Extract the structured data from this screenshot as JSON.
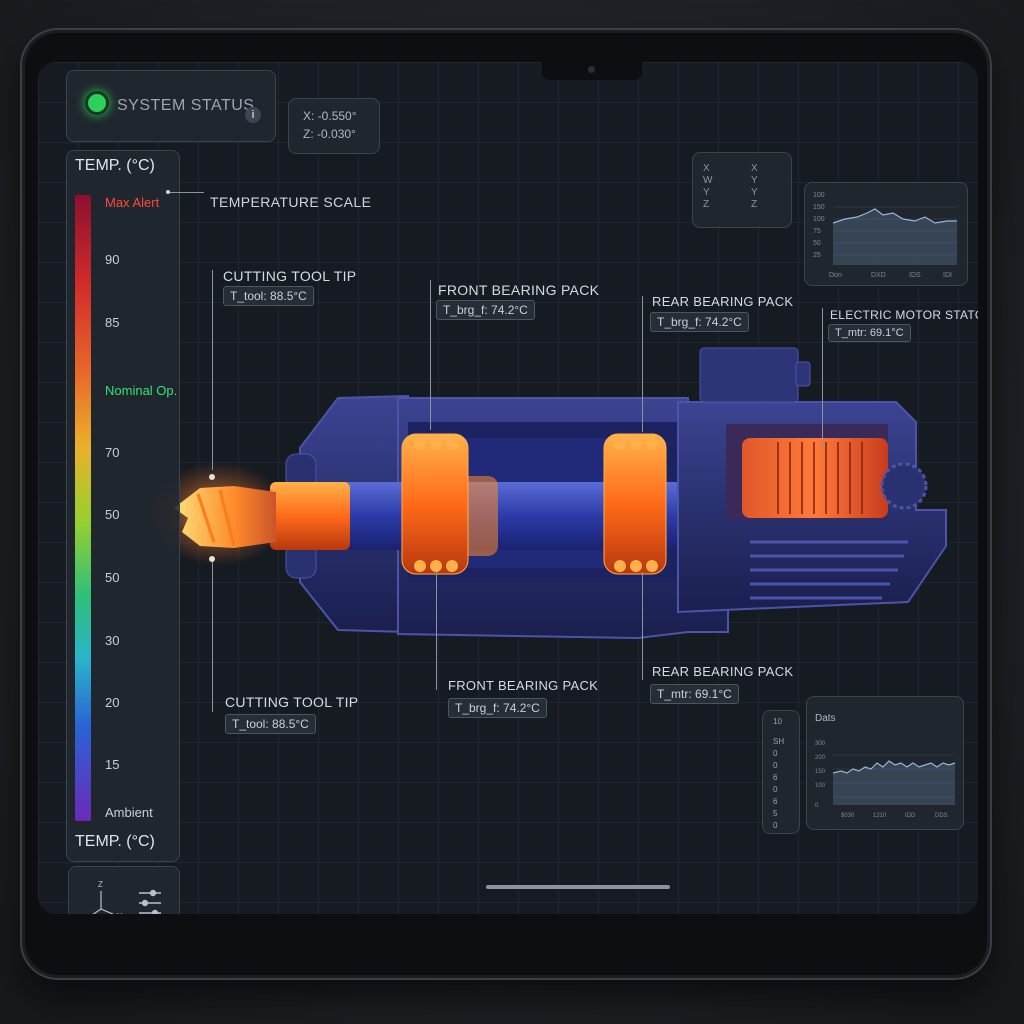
{
  "status": {
    "label": "SYSTEM STATUS",
    "info_glyph": "i",
    "indicator_color": "#2bd15a"
  },
  "coords": {
    "x_label": "X:",
    "x_value": "-0.550°",
    "z_label": "Z:",
    "z_value": "-0.030°"
  },
  "scale": {
    "title_top": "TEMP. (°C)",
    "title_bottom": "TEMP. (°C)",
    "ticks": {
      "max_alert": "Max Alert",
      "t90": "90",
      "t85": "85",
      "nominal": "Nominal Op.",
      "t70": "70",
      "t50a": "50",
      "t50b": "50",
      "t30": "30",
      "t20": "20",
      "t15": "15",
      "ambient": "Ambient"
    },
    "caption": "TEMPERATURE SCALE"
  },
  "callouts": {
    "tool_top": {
      "title": "CUTTING TOOL TIP",
      "value": "T_tool: 88.5°C"
    },
    "front_top": {
      "title": "FRONT BEARING PACK",
      "value": "T_brg_f: 74.2°C"
    },
    "rear_top": {
      "title": "REAR BEARING PACK",
      "value": "T_brg_f: 74.2°C"
    },
    "motor_top": {
      "title": "ELECTRIC MOTOR STATOR",
      "value": "T_mtr: 69.1°C"
    },
    "tool_bottom": {
      "title": "CUTTING TOOL TIP",
      "value": "T_tool: 88.5°C"
    },
    "front_bottom": {
      "title": "FRONT BEARING PACK",
      "value": "T_brg_f: 74.2°C"
    },
    "rear_bottom": {
      "title": "REAR BEARING PACK",
      "value": "T_mtr: 69.1°C"
    }
  },
  "axis_panel": {
    "left_labels": [
      "X",
      "W",
      "Y",
      "Z"
    ],
    "right_labels": [
      "X",
      "Y",
      "Y",
      "Z"
    ]
  },
  "top_chart": {
    "y_ticks": [
      "100",
      "150",
      "100",
      "75",
      "50",
      "25"
    ],
    "x_ticks": [
      "Don",
      "DXD",
      "IDS",
      "IDI"
    ]
  },
  "bottom_chart": {
    "title": "Dats",
    "y_ticks": [
      "300",
      "200",
      "150",
      "100",
      "0"
    ],
    "x_ticks": [
      "$030",
      "1210",
      "IDD",
      "DDS"
    ]
  },
  "mini_panel": {
    "header": "10",
    "items": [
      "SH",
      "0",
      "0",
      "6",
      "0",
      "6",
      "5",
      "0"
    ]
  },
  "colors": {
    "alert": "#ff4a3a",
    "nominal": "#34e07a",
    "hot": "#ff8a2a",
    "housing": "#2a3170"
  },
  "icons": [
    "axis-triad-icon",
    "sliders-icon",
    "info-icon"
  ]
}
